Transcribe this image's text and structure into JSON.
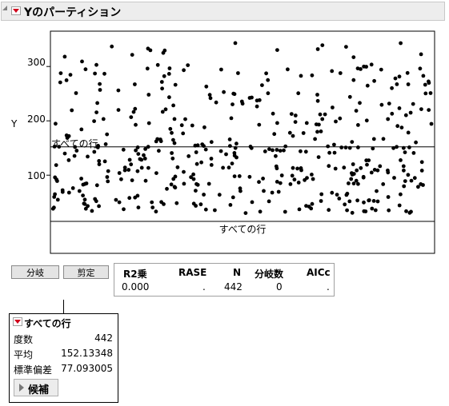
{
  "header": {
    "title": "Yのパーティション"
  },
  "chart_data": {
    "type": "scatter",
    "ylabel": "Y",
    "y_ticks": [
      "100",
      "200",
      "300"
    ],
    "ylim": [
      15,
      365
    ],
    "split_label": "すべての行",
    "mean_line": 152.13,
    "bottom_label": "すべての行",
    "point_count": 442
  },
  "buttons": {
    "split": "分岐",
    "prune": "剪定"
  },
  "stats": {
    "headers": [
      "R2乗",
      "RASE",
      "N",
      "分岐数",
      "AICc"
    ],
    "values": [
      "0.000",
      ".",
      "442",
      "0",
      "."
    ]
  },
  "node": {
    "title": "すべての行",
    "rows": [
      {
        "label": "度数",
        "value": "442"
      },
      {
        "label": "平均",
        "value": "152.13348"
      },
      {
        "label": "標準偏差",
        "value": "77.093005"
      }
    ],
    "candidates": "候補"
  }
}
